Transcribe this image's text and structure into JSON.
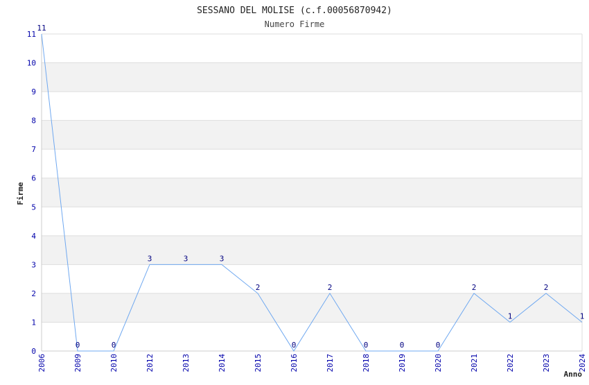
{
  "chart_data": {
    "type": "line",
    "title": "SESSANO DEL MOLISE (c.f.00056870942)",
    "subtitle": "Numero Firme",
    "xlabel": "Anno",
    "ylabel": "Firme",
    "ylim": [
      0,
      11
    ],
    "yticks": [
      "0",
      "1",
      "2",
      "3",
      "4",
      "5",
      "6",
      "7",
      "8",
      "9",
      "10",
      "11"
    ],
    "grid": true,
    "categories": [
      "2006",
      "2009",
      "2010",
      "2012",
      "2013",
      "2014",
      "2015",
      "2016",
      "2017",
      "2018",
      "2019",
      "2020",
      "2021",
      "2022",
      "2023",
      "2024"
    ],
    "values": [
      11,
      0,
      0,
      3,
      3,
      3,
      2,
      0,
      2,
      0,
      0,
      0,
      2,
      1,
      2,
      1
    ],
    "data_labels": [
      "11",
      "0",
      "0",
      "3",
      "3",
      "3",
      "2",
      "0",
      "2",
      "0",
      "0",
      "0",
      "2",
      "1",
      "2",
      "1"
    ],
    "colors": {
      "line": "#6fa8f0",
      "band": "#f2f2f2",
      "grid": "#dddddd",
      "tick_text": "#0000aa",
      "label_text": "#000080"
    }
  }
}
